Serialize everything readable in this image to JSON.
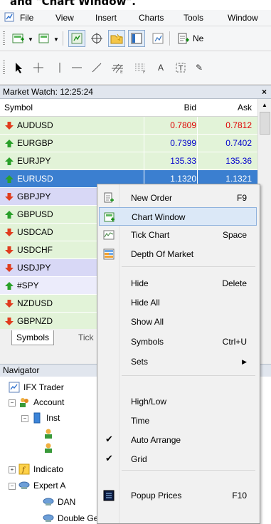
{
  "caption": "and \"Chart Window\".",
  "menu": [
    "File",
    "View",
    "Insert",
    "Charts",
    "Tools",
    "Window"
  ],
  "toolbar": {
    "new_label": "Ne"
  },
  "market_watch": {
    "title": "Market Watch: 12:25:24",
    "close": "×",
    "headers": {
      "symbol": "Symbol",
      "bid": "Bid",
      "ask": "Ask"
    },
    "rows": [
      {
        "symbol": "AUDUSD",
        "bid": "0.7809",
        "ask": "0.7812",
        "dir": "down",
        "price_color": "#e00000",
        "bg": "#e2f3d8"
      },
      {
        "symbol": "EURGBP",
        "bid": "0.7399",
        "ask": "0.7402",
        "dir": "up",
        "price_color": "#0000cc",
        "bg": "#e2f3d8"
      },
      {
        "symbol": "EURJPY",
        "bid": "135.33",
        "ask": "135.36",
        "dir": "up",
        "price_color": "#0000cc",
        "bg": "#e2f3d8"
      },
      {
        "symbol": "EURUSD",
        "bid": "1.1320",
        "ask": "1.1321",
        "dir": "up",
        "price_color": "#ffffff",
        "bg": "#3b7fd0",
        "selected": true
      },
      {
        "symbol": "GBPJPY",
        "bid": "",
        "ask": "",
        "dir": "down",
        "price_color": "#0000cc",
        "bg": "#d8d8f6"
      },
      {
        "symbol": "GBPUSD",
        "bid": "",
        "ask": "",
        "dir": "up",
        "price_color": "#0000cc",
        "bg": "#e2f3d8"
      },
      {
        "symbol": "USDCAD",
        "bid": "",
        "ask": "",
        "dir": "down",
        "price_color": "#0000cc",
        "bg": "#e2f3d8"
      },
      {
        "symbol": "USDCHF",
        "bid": "",
        "ask": "",
        "dir": "down",
        "price_color": "#0000cc",
        "bg": "#e2f3d8"
      },
      {
        "symbol": "USDJPY",
        "bid": "",
        "ask": "",
        "dir": "down",
        "price_color": "#0000cc",
        "bg": "#d8d8f6"
      },
      {
        "symbol": "#SPY",
        "bid": "",
        "ask": "",
        "dir": "up",
        "price_color": "#0000cc",
        "bg": "#ececfb"
      },
      {
        "symbol": "NZDUSD",
        "bid": "",
        "ask": "",
        "dir": "down",
        "price_color": "#0000cc",
        "bg": "#e2f3d8"
      },
      {
        "symbol": "GBPNZD",
        "bid": "",
        "ask": "",
        "dir": "down",
        "price_color": "#0000cc",
        "bg": "#e2f3d8"
      }
    ],
    "tabs": [
      "Symbols",
      "Tick"
    ]
  },
  "navigator": {
    "title": "Navigator",
    "nodes": [
      "IFX Trader",
      "Account",
      "Inst",
      "Indicato",
      "Expert A",
      "DAN",
      "Double Genie"
    ]
  },
  "context_menu": {
    "items": [
      {
        "label": "New Order",
        "shortcut": "F9",
        "icon": "new-order-icon"
      },
      {
        "label": "Chart Window",
        "shortcut": "",
        "icon": "chart-window-icon",
        "highlighted": true
      },
      {
        "label": "Tick Chart",
        "shortcut": "Space",
        "icon": "tick-chart-icon"
      },
      {
        "label": "Depth Of Market",
        "shortcut": "",
        "icon": "depth-of-market-icon"
      },
      {
        "label": "Hide",
        "shortcut": "Delete"
      },
      {
        "label": "Hide All",
        "shortcut": ""
      },
      {
        "label": "Show All",
        "shortcut": ""
      },
      {
        "label": "Symbols",
        "shortcut": "Ctrl+U"
      },
      {
        "label": "Sets",
        "shortcut": "",
        "submenu": true
      },
      {
        "label": "High/Low",
        "shortcut": ""
      },
      {
        "label": "Time",
        "shortcut": ""
      },
      {
        "label": "Auto Arrange",
        "shortcut": "",
        "checked": true
      },
      {
        "label": "Grid",
        "shortcut": "",
        "checked": true
      },
      {
        "label": "Popup Prices",
        "shortcut": "F10",
        "icon": "popup-prices-icon"
      }
    ]
  },
  "colors": {
    "up_arrow": "#2aa02a",
    "down_arrow": "#e03c1e",
    "highlight": "#dbe8f7",
    "selection": "#3b7fd0"
  }
}
